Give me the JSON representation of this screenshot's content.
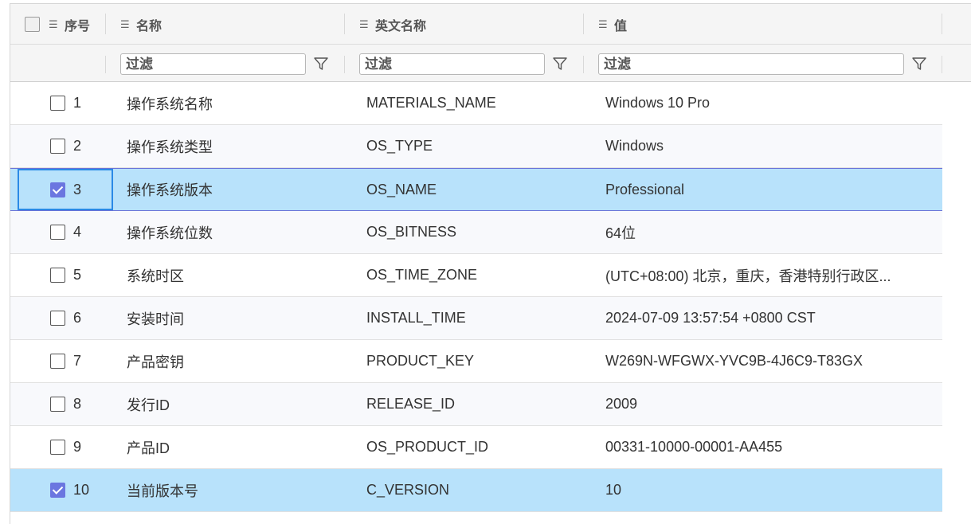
{
  "header": {
    "col_index": "序号",
    "col_name": "名称",
    "col_en_name": "英文名称",
    "col_value": "值"
  },
  "filters": {
    "name_placeholder": "过滤",
    "en_name_placeholder": "过滤",
    "value_placeholder": "过滤"
  },
  "rows": [
    {
      "index": "1",
      "name": "操作系统名称",
      "en_name": "MATERIALS_NAME",
      "value": "Windows 10 Pro",
      "checked": false
    },
    {
      "index": "2",
      "name": "操作系统类型",
      "en_name": "OS_TYPE",
      "value": "Windows",
      "checked": false
    },
    {
      "index": "3",
      "name": "操作系统版本",
      "en_name": "OS_NAME",
      "value": "Professional",
      "checked": true
    },
    {
      "index": "4",
      "name": "操作系统位数",
      "en_name": "OS_BITNESS",
      "value": "64位",
      "checked": false
    },
    {
      "index": "5",
      "name": "系统时区",
      "en_name": "OS_TIME_ZONE",
      "value": "(UTC+08:00) 北京，重庆，香港特别行政区...",
      "checked": false
    },
    {
      "index": "6",
      "name": "安装时间",
      "en_name": "INSTALL_TIME",
      "value": "2024-07-09 13:57:54 +0800 CST",
      "checked": false
    },
    {
      "index": "7",
      "name": "产品密钥",
      "en_name": "PRODUCT_KEY",
      "value": "W269N-WFGWX-YVC9B-4J6C9-T83GX",
      "checked": false
    },
    {
      "index": "8",
      "name": "发行ID",
      "en_name": "RELEASE_ID",
      "value": "2009",
      "checked": false
    },
    {
      "index": "9",
      "name": "产品ID",
      "en_name": "OS_PRODUCT_ID",
      "value": "00331-10000-00001-AA455",
      "checked": false
    },
    {
      "index": "10",
      "name": "当前版本号",
      "en_name": "C_VERSION",
      "value": "10",
      "checked": true
    }
  ],
  "colors": {
    "selected_row": "#b8e2fb",
    "checkbox_checked": "#6b76e0",
    "focus_border": "#2b8ae6"
  }
}
